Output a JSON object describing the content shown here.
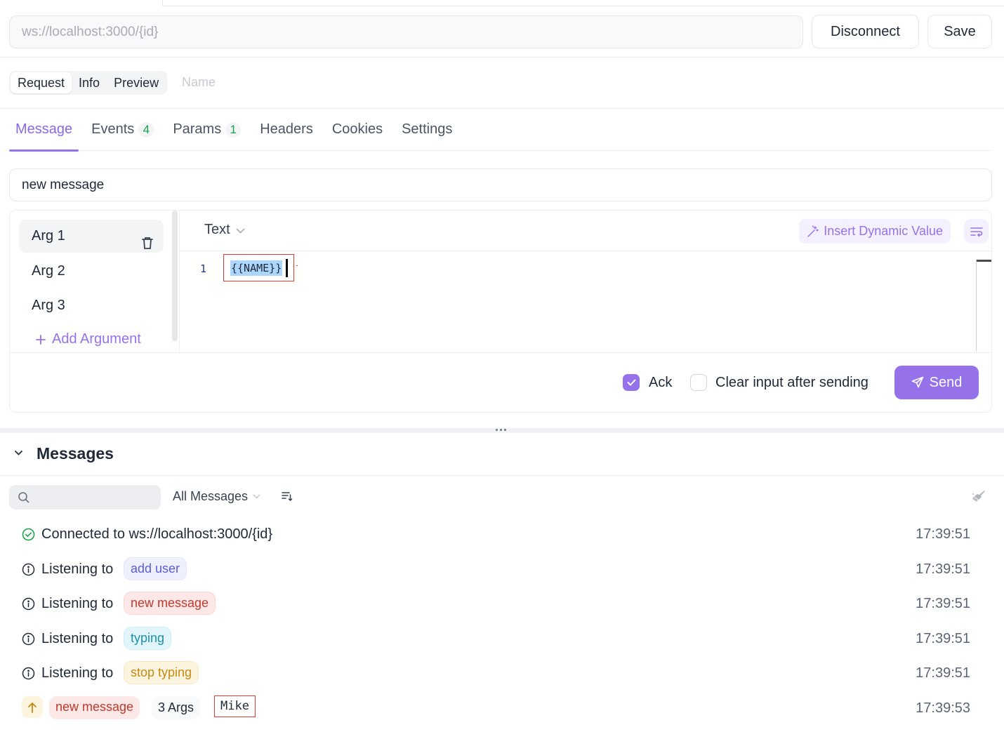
{
  "connection": {
    "url_placeholder": "ws://localhost:3000/{id}",
    "disconnect_label": "Disconnect",
    "save_label": "Save"
  },
  "mode": {
    "segments": [
      "Request",
      "Info",
      "Preview"
    ],
    "active": "Request",
    "name_placeholder": "Name"
  },
  "tabs": [
    {
      "label": "Message",
      "count": null,
      "active": true
    },
    {
      "label": "Events",
      "count": "4"
    },
    {
      "label": "Params",
      "count": "1"
    },
    {
      "label": "Headers",
      "count": null
    },
    {
      "label": "Cookies",
      "count": null
    },
    {
      "label": "Settings",
      "count": null
    }
  ],
  "event_name": "new message",
  "arguments": {
    "items": [
      "Arg 1",
      "Arg 2",
      "Arg 3"
    ],
    "active_index": 0,
    "add_label": "Add Argument"
  },
  "editor": {
    "type": "Text",
    "insert_label": "Insert Dynamic Value",
    "line_number": "1",
    "content": "{{NAME}}"
  },
  "send_options": {
    "ack_label": "Ack",
    "ack_checked": true,
    "clear_label": "Clear input after sending",
    "clear_checked": false,
    "send_label": "Send"
  },
  "messages": {
    "title": "Messages",
    "filter": "All Messages",
    "search_value": "",
    "rows": [
      {
        "type": "connected",
        "text": "Connected to ws://localhost:3000/{id}",
        "time": "17:39:51"
      },
      {
        "type": "listening",
        "text": "Listening to",
        "tag": "add user",
        "color": "indigo",
        "time": "17:39:51"
      },
      {
        "type": "listening",
        "text": "Listening to",
        "tag": "new message",
        "color": "red",
        "time": "17:39:51"
      },
      {
        "type": "listening",
        "text": "Listening to",
        "tag": "typing",
        "color": "cyan",
        "time": "17:39:51"
      },
      {
        "type": "listening",
        "text": "Listening to",
        "tag": "stop typing",
        "color": "amber",
        "time": "17:39:51"
      },
      {
        "type": "sent",
        "tag": "new message",
        "color": "red",
        "args": "3 Args",
        "value": "Mike",
        "time": "17:39:53"
      }
    ]
  },
  "colors": {
    "accent": "#9672ea",
    "success": "#16a34a"
  }
}
